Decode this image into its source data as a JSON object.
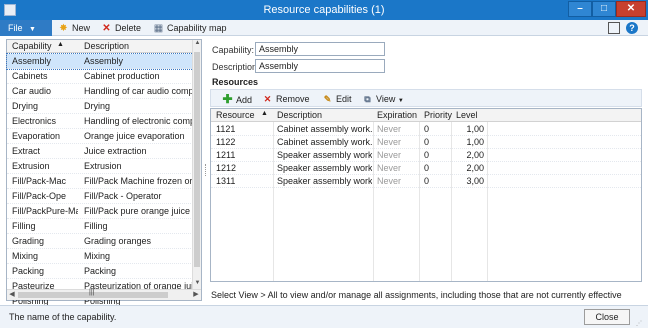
{
  "window": {
    "title": "Resource capabilities (1)"
  },
  "toolbar": {
    "file_label": "File",
    "new_label": "New",
    "delete_label": "Delete",
    "capability_map_label": "Capability map"
  },
  "capabilities_grid": {
    "headers": {
      "capability": "Capability",
      "description": "Description"
    },
    "rows": [
      {
        "capability": "Assembly",
        "description": "Assembly"
      },
      {
        "capability": "Cabinets",
        "description": "Cabinet production"
      },
      {
        "capability": "Car audio",
        "description": "Handling of car audio compone"
      },
      {
        "capability": "Drying",
        "description": "Drying"
      },
      {
        "capability": "Electronics",
        "description": "Handling of electronic compon"
      },
      {
        "capability": "Evaporation",
        "description": "Orange juice evaporation"
      },
      {
        "capability": "Extract",
        "description": "Juice extraction"
      },
      {
        "capability": "Extrusion",
        "description": "Extrusion"
      },
      {
        "capability": "Fill/Pack-Mac",
        "description": "Fill/Pack Machine frozen orang"
      },
      {
        "capability": "Fill/Pack-Ope",
        "description": "Fill/Pack - Operator"
      },
      {
        "capability": "Fill/PackPure-Mac",
        "description": "Fill/Pack pure orange juice"
      },
      {
        "capability": "Filling",
        "description": "Filling"
      },
      {
        "capability": "Grading",
        "description": "Grading oranges"
      },
      {
        "capability": "Mixing",
        "description": "Mixing"
      },
      {
        "capability": "Packing",
        "description": "Packing"
      },
      {
        "capability": "Pasteurize",
        "description": "Pasteurization of orange juice"
      },
      {
        "capability": "Polishing",
        "description": "Polishing"
      }
    ],
    "selected_index": 0
  },
  "details": {
    "capability_label": "Capability:",
    "capability_value": "Assembly",
    "description_label": "Description:",
    "description_value": "Assembly",
    "resources_title": "Resources"
  },
  "resources_toolbar": {
    "add_label": "Add",
    "remove_label": "Remove",
    "edit_label": "Edit",
    "view_label": "View"
  },
  "resources_grid": {
    "headers": {
      "resource": "Resource",
      "description": "Description",
      "expiration": "Expiration",
      "priority": "Priority",
      "level": "Level"
    },
    "rows": [
      {
        "resource": "1121",
        "description": "Cabinet assembly work...",
        "expiration": "Never",
        "priority": "0",
        "level": "1,00"
      },
      {
        "resource": "1122",
        "description": "Cabinet assembly work...",
        "expiration": "Never",
        "priority": "0",
        "level": "1,00"
      },
      {
        "resource": "1211",
        "description": "Speaker assembly work...",
        "expiration": "Never",
        "priority": "0",
        "level": "2,00"
      },
      {
        "resource": "1212",
        "description": "Speaker assembly work...",
        "expiration": "Never",
        "priority": "0",
        "level": "2,00"
      },
      {
        "resource": "1311",
        "description": "Speaker assembly work...",
        "expiration": "Never",
        "priority": "0",
        "level": "3,00"
      }
    ]
  },
  "info_text": "Select View > All to view and/or manage all assignments, including those that are not currently effective",
  "status_bar": {
    "text": "The name of the capability.",
    "close_label": "Close"
  },
  "colors": {
    "titlebar": "#1b77c8",
    "selection": "#cfe5fb",
    "add_icon": "#2e9e2e",
    "remove_icon": "#d0271b"
  }
}
